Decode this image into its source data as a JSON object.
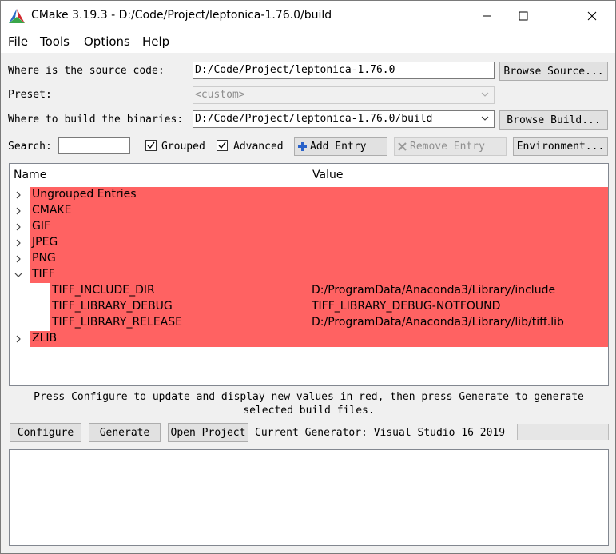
{
  "window": {
    "title": "CMake 3.19.3 - D:/Code/Project/leptonica-1.76.0/build"
  },
  "menu": {
    "file": "File",
    "tools": "Tools",
    "options": "Options",
    "help": "Help"
  },
  "source": {
    "label": "Where is the source code:",
    "value": "D:/Code/Project/leptonica-1.76.0",
    "browse": "Browse Source..."
  },
  "preset": {
    "label": "Preset:",
    "value": "<custom>"
  },
  "build": {
    "label": "Where to build the binaries:",
    "value": "D:/Code/Project/leptonica-1.76.0/build",
    "browse": "Browse Build..."
  },
  "search": {
    "label": "Search:",
    "value": ""
  },
  "options": {
    "grouped": "Grouped",
    "grouped_checked": true,
    "advanced": "Advanced",
    "advanced_checked": true,
    "add_entry": "Add Entry",
    "remove_entry": "Remove Entry",
    "environment": "Environment..."
  },
  "tree": {
    "col_name": "Name",
    "col_value": "Value",
    "rows": [
      {
        "name": "Ungrouped Entries",
        "value": "",
        "level": 0,
        "expanded": false
      },
      {
        "name": "CMAKE",
        "value": "",
        "level": 0,
        "expanded": false
      },
      {
        "name": "GIF",
        "value": "",
        "level": 0,
        "expanded": false
      },
      {
        "name": "JPEG",
        "value": "",
        "level": 0,
        "expanded": false
      },
      {
        "name": "PNG",
        "value": "",
        "level": 0,
        "expanded": false
      },
      {
        "name": "TIFF",
        "value": "",
        "level": 0,
        "expanded": true
      },
      {
        "name": "TIFF_INCLUDE_DIR",
        "value": "D:/ProgramData/Anaconda3/Library/include",
        "level": 1
      },
      {
        "name": "TIFF_LIBRARY_DEBUG",
        "value": "TIFF_LIBRARY_DEBUG-NOTFOUND",
        "level": 1
      },
      {
        "name": "TIFF_LIBRARY_RELEASE",
        "value": "D:/ProgramData/Anaconda3/Library/lib/tiff.lib",
        "level": 1
      },
      {
        "name": "ZLIB",
        "value": "",
        "level": 0,
        "expanded": false
      }
    ],
    "highlight_color": "#ff6262"
  },
  "hint": {
    "line1": "Press Configure to update and display new values in red, then press Generate to generate",
    "line2": "selected build files."
  },
  "actions": {
    "configure": "Configure",
    "generate": "Generate",
    "open_project": "Open Project",
    "generator": "Current Generator: Visual Studio 16 2019"
  }
}
